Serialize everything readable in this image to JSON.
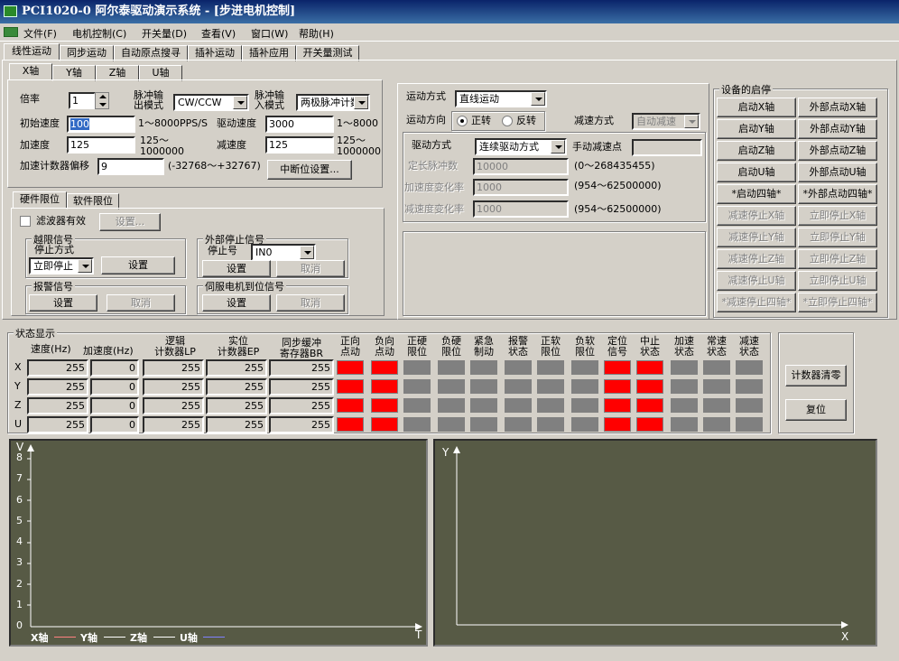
{
  "window": {
    "title": "PCI1020-0 阿尔泰驱动演示系统 - [步进电机控制]"
  },
  "menu": [
    "文件(F)",
    "电机控制(C)",
    "开关量(D)",
    "查看(V)",
    "窗口(W)",
    "帮助(H)"
  ],
  "main_tabs": [
    "线性运动",
    "同步运动",
    "自动原点搜寻",
    "插补运动",
    "插补应用",
    "开关量测试"
  ],
  "axis_tabs": [
    "X轴",
    "Y轴",
    "Z轴",
    "U轴"
  ],
  "params": {
    "ratio_label": "倍率",
    "ratio_value": "1",
    "pulse_out_label_1": "脉冲输",
    "pulse_out_label_2": "出模式",
    "pulse_out_value": "CW/CCW",
    "pulse_in_label_1": "脉冲输",
    "pulse_in_label_2": "入模式",
    "pulse_in_value": "两极脉冲计数",
    "init_speed_label": "初始速度",
    "init_speed_value": "100",
    "init_speed_range": "1～8000PPS/S",
    "drive_speed_label": "驱动速度",
    "drive_speed_value": "3000",
    "drive_speed_range": "1～8000",
    "accel_label": "加速度",
    "accel_value": "125",
    "accel_range_1": "125～",
    "accel_range_2": "1000000",
    "decel_label": "减速度",
    "decel_value": "125",
    "decel_range_1": "125～",
    "decel_range_2": "1000000",
    "counter_offset_label": "加速计数器偏移",
    "counter_offset_value": "9",
    "counter_offset_range": "(-32768～+32767)",
    "interrupt_button": "中断位设置..."
  },
  "limit_tabs": [
    "硬件限位",
    "软件限位"
  ],
  "hardware": {
    "filter_label": "滤波器有效",
    "filter_setup": "设置...",
    "overlimit_group": "越限信号",
    "stop_mode_label": "停止方式",
    "stop_mode_value": "立即停止",
    "overlimit_setup": "设置",
    "ext_stop_group": "外部停止信号",
    "stop_no_label": "停止号",
    "stop_no_value": "IN0",
    "ext_setup": "设置",
    "ext_cancel": "取消",
    "alarm_group": "报警信号",
    "alarm_setup": "设置",
    "alarm_cancel": "取消",
    "servo_group": "伺服电机到位信号",
    "servo_setup": "设置",
    "servo_cancel": "取消"
  },
  "motion": {
    "mode_label": "运动方式",
    "mode_value": "直线运动",
    "dir_label": "运动方向",
    "dir_forward": "正转",
    "dir_reverse": "反转",
    "decel_mode_label": "减速方式",
    "decel_mode_value": "自动减速",
    "drive_mode_label": "驱动方式",
    "drive_mode_value": "连续驱动方式",
    "manual_decel_label": "手动减速点",
    "manual_decel_value": "",
    "fixed_pulse_label": "定长脉冲数",
    "fixed_pulse_value": "10000",
    "fixed_pulse_range": "(0～268435455)",
    "accel_rate_label": "加速度变化率",
    "accel_rate_value": "1000",
    "accel_rate_range": "(954～62500000)",
    "decel_rate_label": "减速度变化率",
    "decel_rate_value": "1000",
    "decel_rate_range": "(954～62500000)"
  },
  "device": {
    "group": "设备的启停",
    "buttons": [
      [
        "启动X轴",
        "外部点动X轴"
      ],
      [
        "启动Y轴",
        "外部点动Y轴"
      ],
      [
        "启动Z轴",
        "外部点动Z轴"
      ],
      [
        "启动U轴",
        "外部点动U轴"
      ],
      [
        "*启动四轴*",
        "*外部点动四轴*"
      ],
      [
        "减速停止X轴",
        "立即停止X轴"
      ],
      [
        "减速停止Y轴",
        "立即停止Y轴"
      ],
      [
        "减速停止Z轴",
        "立即停止Z轴"
      ],
      [
        "减速停止U轴",
        "立即停止U轴"
      ],
      [
        "*减速停止四轴*",
        "*立即停止四轴*"
      ]
    ]
  },
  "status": {
    "group": "状态显示",
    "col_speed": "速度(Hz)",
    "col_accel": "加速度(Hz)",
    "col_lp_1": "逻辑",
    "col_lp_2": "计数器LP",
    "col_ep_1": "实位",
    "col_ep_2": "计数器EP",
    "col_br_1": "同步缓冲",
    "col_br_2": "寄存器BR",
    "flag_headers": [
      [
        "正向",
        "点动"
      ],
      [
        "负向",
        "点动"
      ],
      [
        "正硬",
        "限位"
      ],
      [
        "负硬",
        "限位"
      ],
      [
        "紧急",
        "制动"
      ],
      [
        "报警",
        "状态"
      ],
      [
        "正软",
        "限位"
      ],
      [
        "负软",
        "限位"
      ],
      [
        "定位",
        "信号"
      ],
      [
        "中止",
        "状态"
      ],
      [
        "加速",
        "状态"
      ],
      [
        "常速",
        "状态"
      ],
      [
        "减速",
        "状态"
      ]
    ],
    "rows": [
      {
        "axis": "X",
        "speed": "255",
        "accel": "0",
        "lp": "255",
        "ep": "255",
        "br": "255",
        "flags": [
          1,
          1,
          0,
          0,
          0,
          0,
          0,
          0,
          1,
          1,
          0,
          0,
          0
        ]
      },
      {
        "axis": "Y",
        "speed": "255",
        "accel": "0",
        "lp": "255",
        "ep": "255",
        "br": "255",
        "flags": [
          1,
          1,
          0,
          0,
          0,
          0,
          0,
          0,
          1,
          1,
          0,
          0,
          0
        ]
      },
      {
        "axis": "Z",
        "speed": "255",
        "accel": "0",
        "lp": "255",
        "ep": "255",
        "br": "255",
        "flags": [
          1,
          1,
          0,
          0,
          0,
          0,
          0,
          0,
          1,
          1,
          0,
          0,
          0
        ]
      },
      {
        "axis": "U",
        "speed": "255",
        "accel": "0",
        "lp": "255",
        "ep": "255",
        "br": "255",
        "flags": [
          1,
          1,
          0,
          0,
          0,
          0,
          0,
          0,
          1,
          1,
          0,
          0,
          0
        ]
      }
    ],
    "clear_button": "计数器清零",
    "reset_button": "复位"
  },
  "plot_left": {
    "y_label": "V",
    "x_label": "T",
    "y_ticks": [
      "8",
      "7",
      "6",
      "5",
      "4",
      "3",
      "2",
      "1",
      "0"
    ],
    "legend": [
      {
        "name": "X轴",
        "color": "#ff8080"
      },
      {
        "name": "Y轴",
        "color": "#ffffff"
      },
      {
        "name": "Z轴",
        "color": "#ffffff"
      },
      {
        "name": "U轴",
        "color": "#8080ff"
      }
    ]
  },
  "plot_right": {
    "y_label": "Y",
    "x_label": "X"
  },
  "colors": {
    "led_on": "#ff0000",
    "led_off": "#808080",
    "plot_bg": "#575a45"
  }
}
